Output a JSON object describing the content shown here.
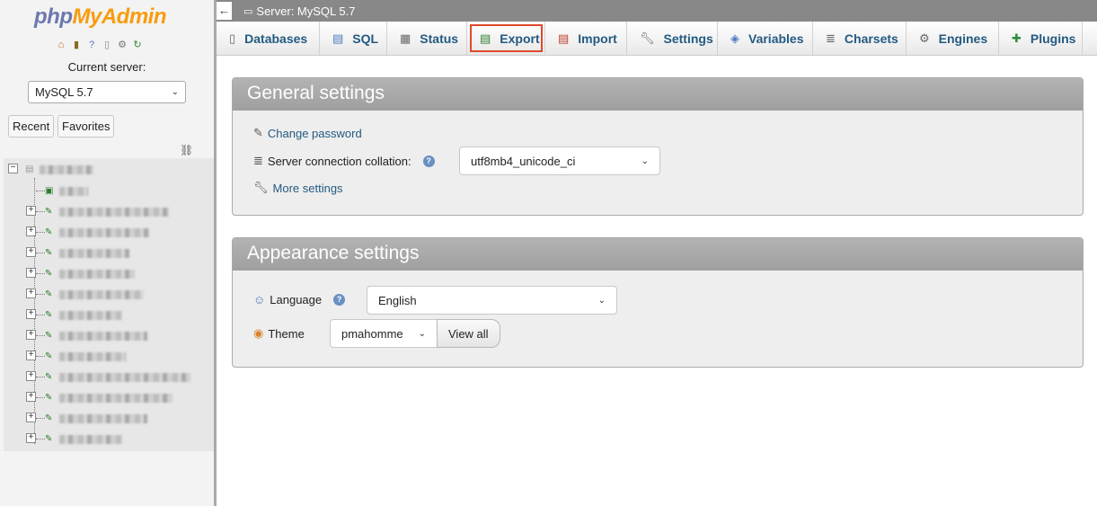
{
  "logo": {
    "part1": "php",
    "part2": "MyAdmin"
  },
  "nav": {
    "icons": [
      "home-icon",
      "logout-icon",
      "help-icon",
      "docs-icon",
      "settings-icon",
      "reload-icon"
    ],
    "current_server_label": "Current server:",
    "server_select_value": "MySQL 5.7",
    "recent_label": "Recent",
    "favorites_label": "Favorites"
  },
  "topbar": {
    "title": "Server: MySQL 5.7"
  },
  "tabs": [
    {
      "label": "Databases",
      "icon": "database-icon"
    },
    {
      "label": "SQL",
      "icon": "sql-icon"
    },
    {
      "label": "Status",
      "icon": "status-icon"
    },
    {
      "label": "Export",
      "icon": "export-icon",
      "active": true
    },
    {
      "label": "Import",
      "icon": "import-icon"
    },
    {
      "label": "Settings",
      "icon": "wrench-icon"
    },
    {
      "label": "Variables",
      "icon": "variables-icon"
    },
    {
      "label": "Charsets",
      "icon": "charsets-icon"
    },
    {
      "label": "Engines",
      "icon": "engines-icon"
    },
    {
      "label": "Plugins",
      "icon": "plugin-icon"
    }
  ],
  "general": {
    "title": "General settings",
    "change_password": "Change password",
    "collation_label": "Server connection collation:",
    "collation_value": "utf8mb4_unicode_ci",
    "more_settings": "More settings"
  },
  "appearance": {
    "title": "Appearance settings",
    "language_label": "Language",
    "language_value": "English",
    "theme_label": "Theme",
    "theme_value": "pmahomme",
    "view_all": "View all"
  },
  "colors": {
    "accent": "#235a81",
    "active_outline": "#e0492a",
    "logo_php": "#6c78af",
    "logo_admin": "#f89c0e"
  }
}
